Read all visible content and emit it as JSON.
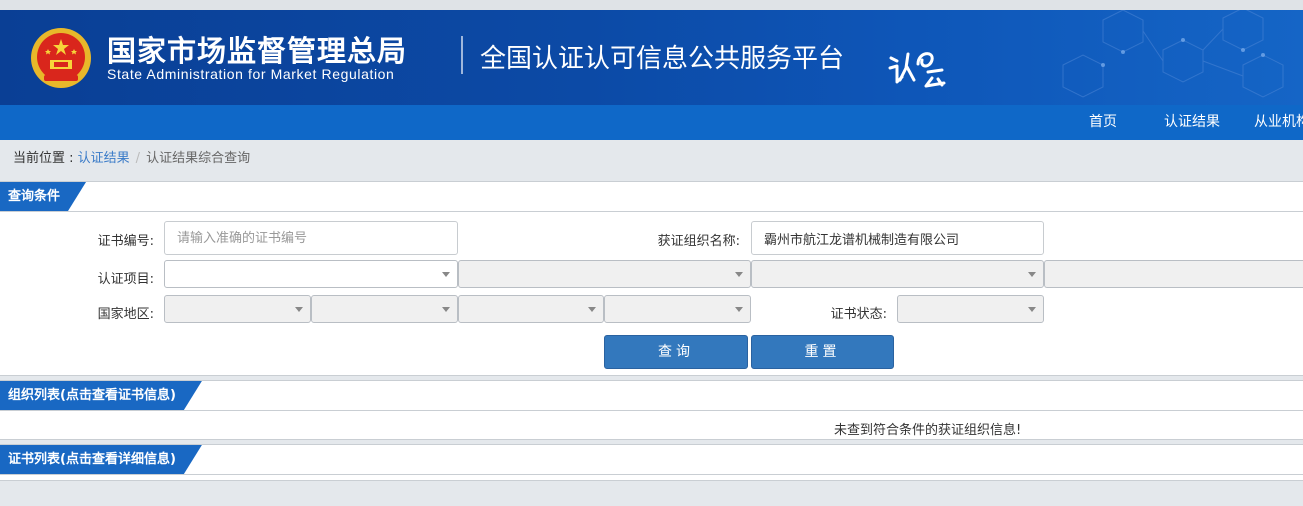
{
  "header": {
    "agency_cn": "国家市场监督管理总局",
    "agency_en": "State Administration  for  Market Regulation",
    "platform_title": "全国认证认可信息公共服务平台",
    "emblem_icon": "national-emblem-icon",
    "logo_icon": "renzheng-yun-logo-icon",
    "colors": {
      "banner": "#0c4aa6",
      "nav": "#0f68c8",
      "emblem": "#d9261c"
    }
  },
  "nav": {
    "items": [
      "首页",
      "认证结果",
      "从业机构"
    ]
  },
  "breadcrumb": {
    "label": "当前位置 : ",
    "link": "认证结果",
    "separator": "/",
    "current": "认证结果综合查询"
  },
  "query": {
    "section_title": "查询条件",
    "cert_no_label": "证书编号:",
    "cert_no_placeholder": "请输入准确的证书编号",
    "org_name_label": "获证组织名称:",
    "org_name_value": "霸州市航江龙谱机械制造有限公司",
    "project_label": "认证项目:",
    "region_label": "国家地区:",
    "status_label": "证书状态:",
    "search_button": "查询",
    "reset_button": "重置",
    "colors": {
      "tag": "#1968c3",
      "button": "#3378bd"
    }
  },
  "org_list": {
    "section_title": "组织列表(点击查看证书信息)",
    "empty_message": "未查到符合条件的获证组织信息!"
  },
  "cert_list": {
    "section_title": "证书列表(点击查看详细信息)"
  }
}
